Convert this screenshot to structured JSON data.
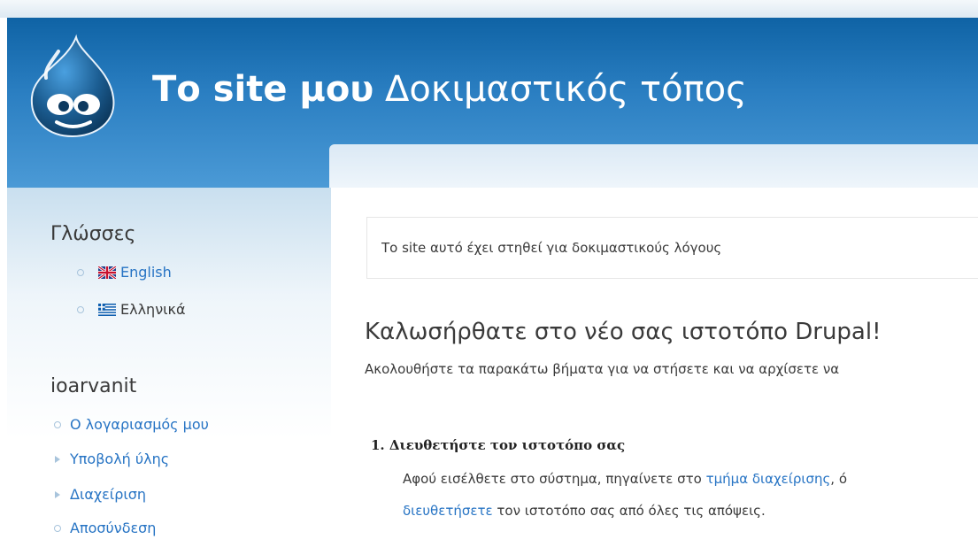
{
  "colors": {
    "header_blue": "#2b7fc2",
    "link_blue": "#2774c4",
    "text": "#3a3a3a"
  },
  "header": {
    "site_name": "Το site μου",
    "site_slogan": "Δοκιμαστικός τόπος",
    "logo_icon": "drupal-drop-logo"
  },
  "sidebar": {
    "languages": {
      "title": "Γλώσσες",
      "items": [
        {
          "label": "English",
          "flag": "uk-flag-icon"
        },
        {
          "label": "Ελληνικά",
          "flag": "greek-flag-icon"
        }
      ]
    },
    "user_menu": {
      "title": "ioarvanit",
      "items": [
        {
          "label": "Ο λογαριασμός μου"
        },
        {
          "label": "Υποβολή ύλης"
        },
        {
          "label": "Διαχείριση"
        },
        {
          "label": "Αποσύνδεση"
        }
      ]
    }
  },
  "main": {
    "mission": "Το site αυτό έχει στηθεί για δοκιμαστικούς λόγους",
    "welcome_title": "Καλωσήρθατε στο νέο σας ιστοτόπο Drupal!",
    "welcome_sub": "Ακολουθήστε τα παρακάτω βήματα για να στήσετε και να αρχίσετε να",
    "step1": {
      "heading": "1.  Διευθετήστε τον ιστοτόπο σας",
      "line1_prefix": "Αφού εισέλθετε στο σύστημα, πηγαίνετε στο ",
      "line1_link": "τμήμα διαχείρισης",
      "line1_suffix": ", ό",
      "line2_link": "διευθετήσετε",
      "line2_suffix": " τον ιστοτόπο σας από όλες τις απόψεις."
    }
  }
}
